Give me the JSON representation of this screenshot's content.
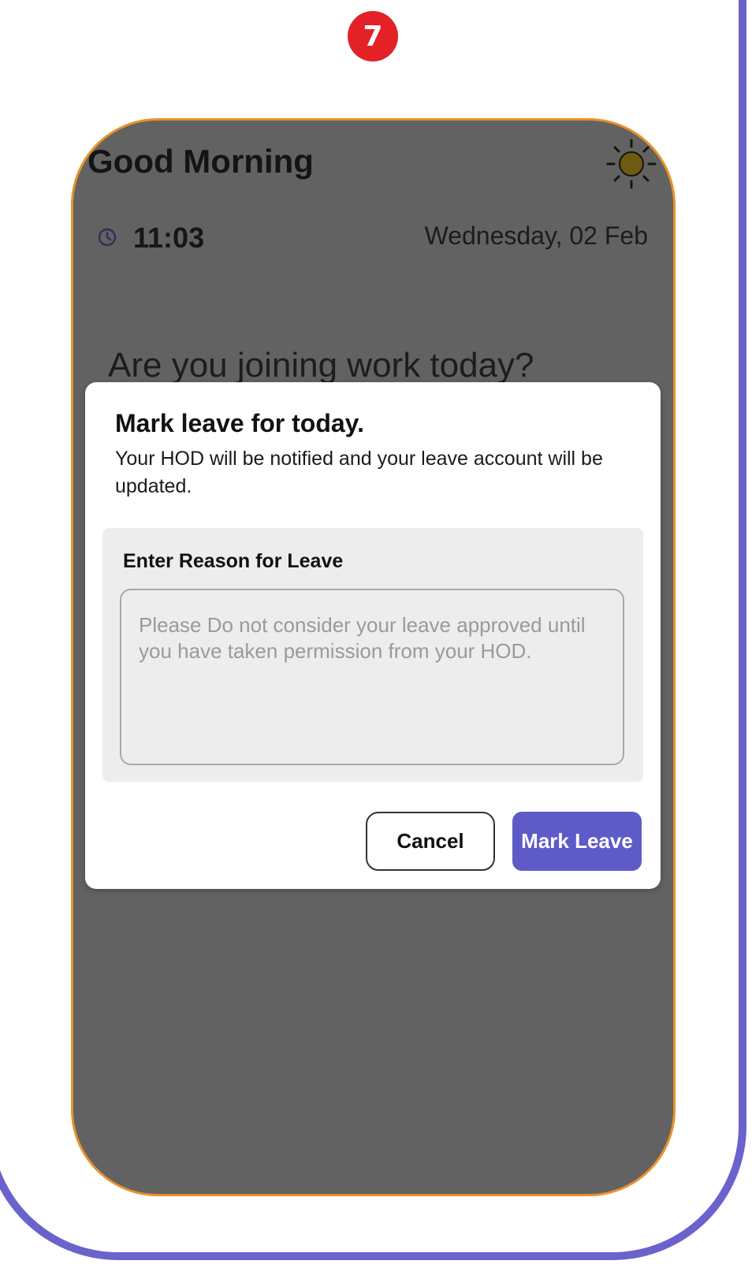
{
  "step_badge": "7",
  "header": {
    "greeting": "Good Morning",
    "time": "11:03",
    "date": "Wednesday, 02 Feb",
    "weather_icon": "sun-icon",
    "time_icon": "clock-icon"
  },
  "main": {
    "question": "Are you joining work today?"
  },
  "dialog": {
    "title": "Mark leave for today.",
    "message": "Your HOD will be notified and your leave account will be updated.",
    "reason_label": "Enter Reason for Leave",
    "reason_placeholder": "Please Do not consider your leave approved until you have taken permission from your HOD.",
    "reason_value": "",
    "cancel_label": "Cancel",
    "confirm_label": "Mark Leave"
  },
  "colors": {
    "accent": "#5e5bc9",
    "frame": "#6a63cc",
    "badge": "#e32127",
    "phone_border": "#e8922a",
    "overlay": "#626262"
  }
}
